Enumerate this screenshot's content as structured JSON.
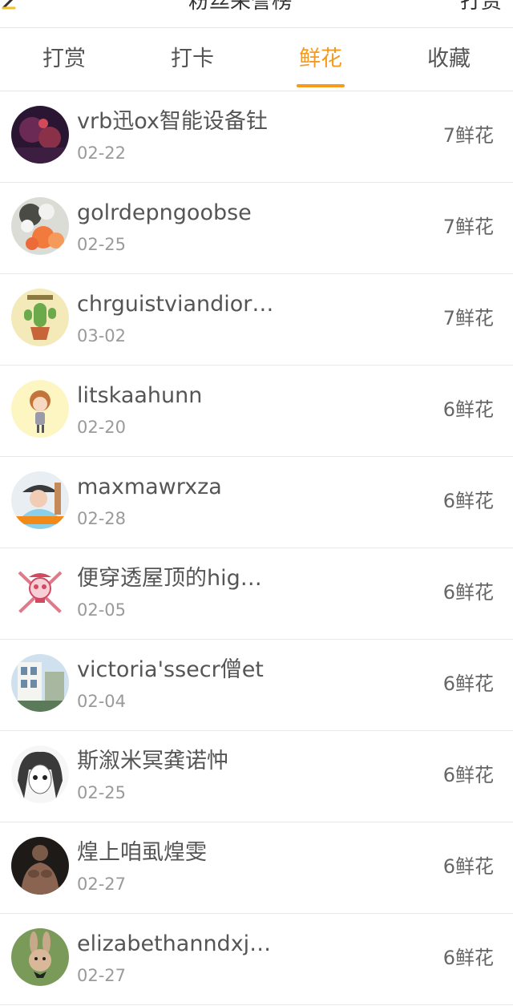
{
  "header": {
    "title": "粉丝荣誉榜",
    "action_label": "打赏"
  },
  "tabs": [
    {
      "label": "打赏",
      "active": false
    },
    {
      "label": "打卡",
      "active": false
    },
    {
      "label": "鲜花",
      "active": true
    },
    {
      "label": "收藏",
      "active": false
    }
  ],
  "colors": {
    "accent": "#f39a1f",
    "text": "#555555",
    "muted": "#9a9a9a"
  },
  "rows": [
    {
      "name": "vrb迅ox智能设备钍",
      "date": "02-22",
      "amount": "7鲜花",
      "avatar": "dark-purple-photo-avatar"
    },
    {
      "name": "golrdepngoobse",
      "date": "02-25",
      "amount": "7鲜花",
      "avatar": "white-flowers-avatar"
    },
    {
      "name": "chrguistviandior…",
      "date": "03-02",
      "amount": "7鲜花",
      "avatar": "green-cactus-avatar"
    },
    {
      "name": "litskaahunn",
      "date": "02-20",
      "amount": "6鲜花",
      "avatar": "cartoon-girl-avatar"
    },
    {
      "name": "maxmawrxza",
      "date": "02-28",
      "amount": "6鲜花",
      "avatar": "boy-with-hat-avatar"
    },
    {
      "name": "便穿透屋顶的hig…",
      "date": "02-05",
      "amount": "6鲜花",
      "avatar": "pink-skull-avatar"
    },
    {
      "name": "victoria'ssecr僧et",
      "date": "02-04",
      "amount": "6鲜花",
      "avatar": "building-photo-avatar"
    },
    {
      "name": "斯溆米冥龚诺忡",
      "date": "02-25",
      "amount": "6鲜花",
      "avatar": "manga-girl-avatar"
    },
    {
      "name": "煌上咱虱煌雯",
      "date": "02-27",
      "amount": "6鲜花",
      "avatar": "muscle-man-avatar"
    },
    {
      "name": "elizabethanndxj…",
      "date": "02-27",
      "amount": "6鲜花",
      "avatar": "rabbit-avatar"
    }
  ]
}
